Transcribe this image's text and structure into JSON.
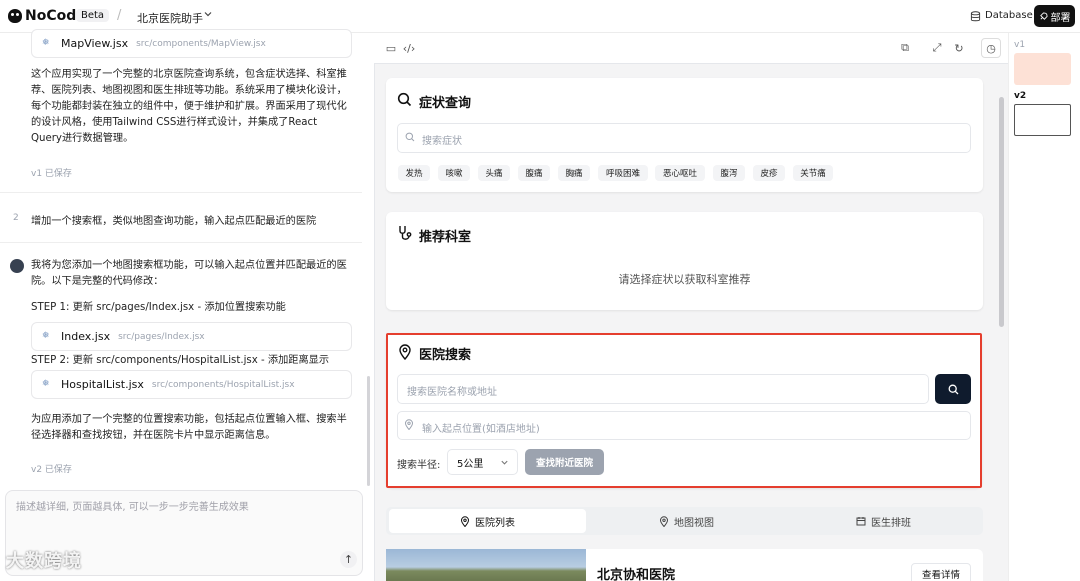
{
  "topbar": {
    "brand": "NoCode",
    "beta": "Beta",
    "separator": "/",
    "project": "北京医院助手",
    "database": "Database",
    "deploy": "部署"
  },
  "chat": {
    "file_top": {
      "name": "MapView.jsx",
      "path": "src/components/MapView.jsx"
    },
    "summary1": "这个应用实现了一个完整的北京医院查询系统，包含症状选择、科室推荐、医院列表、地图视图和医生排班等功能。系统采用了模块化设计，每个功能都封装在独立的组件中，便于维护和扩展。界面采用了现代化的设计风格，使用Tailwind CSS进行样式设计，并集成了React Query进行数据管理。",
    "saved1": "v1 已保存",
    "step_no": "2",
    "user_msg": "增加一个搜索框，类似地图查询功能，输入起点匹配最近的医院",
    "ai_intro": "我将为您添加一个地图搜索框功能，可以输入起点位置并匹配最近的医院。以下是完整的代码修改：",
    "step1": "STEP 1: 更新 src/pages/Index.jsx - 添加位置搜索功能",
    "file1": {
      "name": "Index.jsx",
      "path": "src/pages/Index.jsx"
    },
    "step2": "STEP 2: 更新 src/components/HospitalList.jsx - 添加距离显示",
    "file2": {
      "name": "HospitalList.jsx",
      "path": "src/components/HospitalList.jsx"
    },
    "summary2": "为应用添加了一个完整的位置搜索功能，包括起点位置输入框、搜索半径选择器和查找按钮，并在医院卡片中显示距离信息。",
    "saved2": "v2 已保存",
    "input_placeholder": "描述越详细, 页面越具体, 可以一步一步完善生成效果",
    "watermark": "大数跨境"
  },
  "preview": {
    "symptom": {
      "title": "症状查询",
      "placeholder": "搜索症状",
      "tags": [
        "发热",
        "咳嗽",
        "头痛",
        "腹痛",
        "胸痛",
        "呼吸困难",
        "恶心呕吐",
        "腹泻",
        "皮疹",
        "关节痛"
      ]
    },
    "dept": {
      "title": "推荐科室",
      "empty": "请选择症状以获取科室推荐"
    },
    "hospital_search": {
      "title": "医院搜索",
      "name_placeholder": "搜索医院名称或地址",
      "start_placeholder": "输入起点位置(如酒店地址)",
      "radius_label": "搜索半径:",
      "radius_value": "5公里",
      "find_button": "查找附近医院"
    },
    "tabs": [
      "医院列表",
      "地图视图",
      "医生排班"
    ],
    "hospital_card": {
      "name": "北京协和医院",
      "detail_button": "查看详情"
    }
  },
  "versions": {
    "v1": "v1",
    "v2": "v2"
  },
  "colors": {
    "highlight": "#e53e2e",
    "primary_dark": "#0f1b2d",
    "disabled_button": "#9ca3af"
  }
}
